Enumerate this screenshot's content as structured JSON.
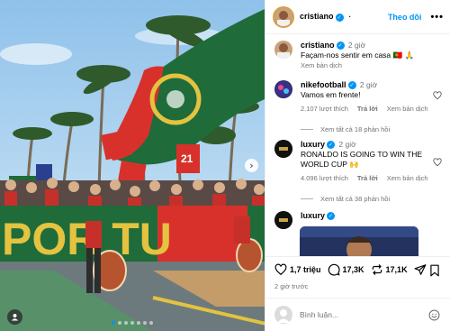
{
  "post": {
    "author": "cristiano",
    "follow_label": "Theo dõi",
    "more_label": "•••",
    "next_arrow": "›",
    "slide_count": 7,
    "active_slide": 1,
    "photo_banner_text": "POR   TU",
    "photo_sign_number": "21"
  },
  "caption": {
    "user": "cristiano",
    "time": "2 giờ",
    "text": "Façam-nos sentir em casa 🇵🇹 🙏",
    "translate": "Xem bản dịch"
  },
  "comments": [
    {
      "user": "nikefootball",
      "time": "2 giờ",
      "text": "Vamos em frente!",
      "likes": "2.107 lượt thích",
      "reply": "Trả lời",
      "translate": "Xem bản dịch",
      "view_replies": "Xem tất cả 18 phản hồi"
    },
    {
      "user": "luxury",
      "time": "2 giờ",
      "text": "RONALDO IS GOING TO WIN THE WORLD CUP 🙌",
      "likes": "4.096 lượt thích",
      "reply": "Trả lời",
      "translate": "Xem bản dịch",
      "view_replies": "Xem tất cả 38 phản hồi"
    },
    {
      "user": "luxury"
    }
  ],
  "actions": {
    "likes": "1,7 triệu",
    "comments": "17,3K",
    "shares": "17,1K",
    "date": "2 giờ trước"
  },
  "add_comment": {
    "placeholder": "Bình luận..."
  },
  "colors": {
    "accent": "#0095f6",
    "portugal_green": "#1f6b3a",
    "portugal_red": "#d8312b"
  }
}
